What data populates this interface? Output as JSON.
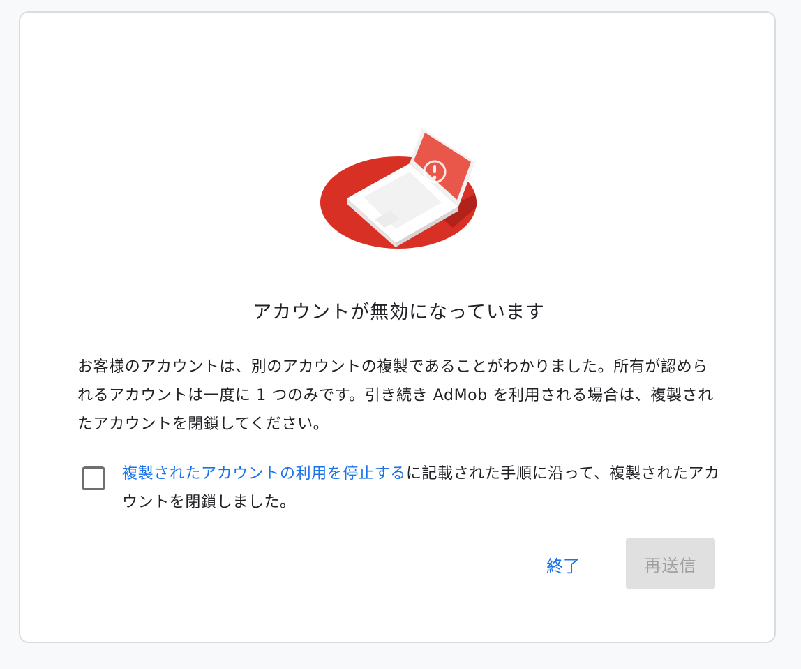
{
  "dialog": {
    "title": "アカウントが無効になっています",
    "body": "お客様のアカウントは、別のアカウントの複製であることがわかりました。所有が認められるアカウントは一度に 1 つのみです。引き続き AdMob を利用される場合は、複製されたアカウントを閉鎖してください。",
    "confirm": {
      "checked": false,
      "link_text": "複製されたアカウントの利用を停止する",
      "suffix_text": "に記載された手順に沿って、複製されたアカウントを閉鎖しました。"
    },
    "buttons": {
      "exit_label": "終了",
      "resend_label": "再送信",
      "resend_disabled": true
    },
    "illustration": {
      "icon": "laptop-warning-icon",
      "accent_color": "#d93025",
      "screen_color": "#e8574a"
    }
  }
}
